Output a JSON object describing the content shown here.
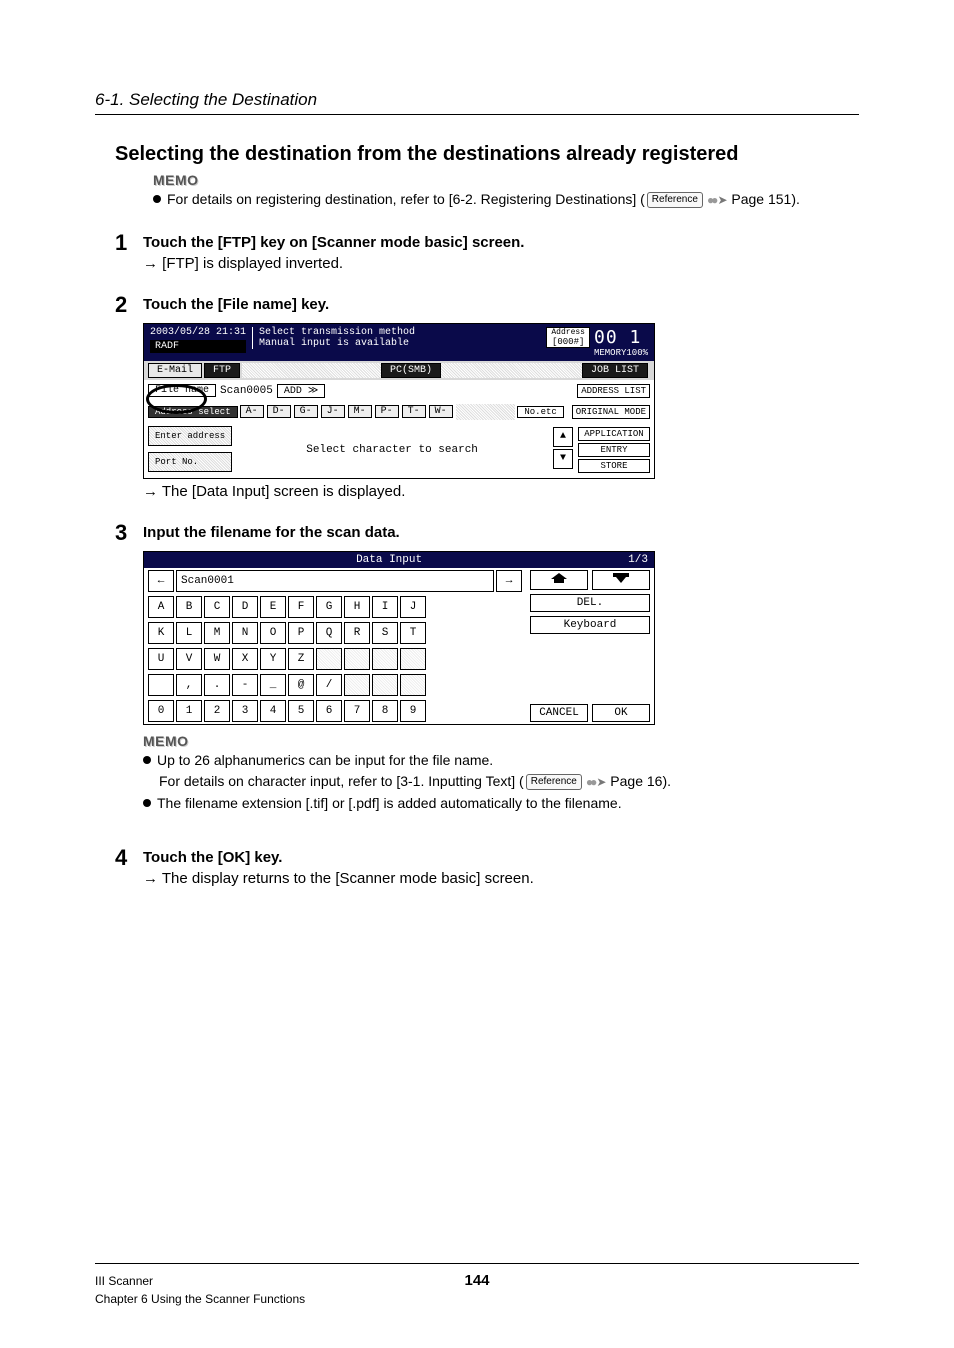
{
  "section_header": "6-1. Selecting the Destination",
  "title": "Selecting the destination from the destinations already registered",
  "memo_label": "MEMO",
  "memo1_text": "For details on registering destination, refer to [6-2. Registering Destinations] (",
  "memo1_page": " Page 151).",
  "reference_label": "Reference",
  "steps": {
    "s1": {
      "num": "1",
      "title": "Touch the [FTP] key on [Scanner mode basic] screen.",
      "note_arrow": "→",
      "note": " [FTP] is displayed inverted."
    },
    "s2": {
      "num": "2",
      "title": "Touch the [File name] key.",
      "note_arrow": "→",
      "note": " The [Data Input] screen is displayed."
    },
    "s3": {
      "num": "3",
      "title": "Input the filename for the scan data."
    },
    "s4": {
      "num": "4",
      "title": "Touch the [OK] key.",
      "note_arrow": "→",
      "note": " The display returns to the [Scanner mode basic] screen."
    }
  },
  "memo2": {
    "line1": "Up to 26 alphanumerics can be input for the file name.",
    "line2a": "For details on character input, refer to [3-1. Inputting Text] (",
    "line2b": " Page 16).",
    "line3": "The filename extension [.tif] or [.pdf] is added automatically to the filename."
  },
  "panel1": {
    "datetime": "2003/05/28 21:31",
    "msg1": "Select transmission method",
    "msg2": "Manual input is available",
    "address_label": "Address",
    "address_count": "[000#]",
    "ready_count": "00 1",
    "memory_label": "MEMORY100%",
    "mode_label": "RADF",
    "tab_email": "E-Mail",
    "tab_ftp": "FTP",
    "tab_pcsmb": "PC(SMB)",
    "joblist": "JOB LIST",
    "filename_label": "File name",
    "filename_value": "Scan0005",
    "add_btn": "ADD ≫",
    "addresslist": "ADDRESS LIST",
    "addr_select": "Address select",
    "index": [
      "A-",
      "D-",
      "G-",
      "J-",
      "M-",
      "P-",
      "T-",
      "W-"
    ],
    "noetc": "No.etc",
    "original_mode": "ORIGINAL MODE",
    "enter_addr": "Enter address",
    "portno": "Port No.",
    "search_hint": "Select character to search",
    "application": "APPLICATION",
    "entry": "ENTRY",
    "store": "STORE"
  },
  "panel2": {
    "title": "Data Input",
    "page": "1/3",
    "nav_left": "←",
    "nav_right": "→",
    "input_value": "Scan0001",
    "row1": [
      "A",
      "B",
      "C",
      "D",
      "E",
      "F",
      "G",
      "H",
      "I",
      "J"
    ],
    "row2": [
      "K",
      "L",
      "M",
      "N",
      "O",
      "P",
      "Q",
      "R",
      "S",
      "T"
    ],
    "row3": [
      "U",
      "V",
      "W",
      "X",
      "Y",
      "Z"
    ],
    "row4": [
      " ",
      ",",
      ".",
      "-",
      "_",
      "@",
      "/"
    ],
    "row5": [
      "0",
      "1",
      "2",
      "3",
      "4",
      "5",
      "6",
      "7",
      "8",
      "9"
    ],
    "del": "DEL.",
    "keyboard": "Keyboard",
    "cancel": "CANCEL",
    "ok": "OK"
  },
  "footer": {
    "left1": "III Scanner",
    "left2": "Chapter 6 Using the Scanner Functions",
    "page": "144"
  }
}
